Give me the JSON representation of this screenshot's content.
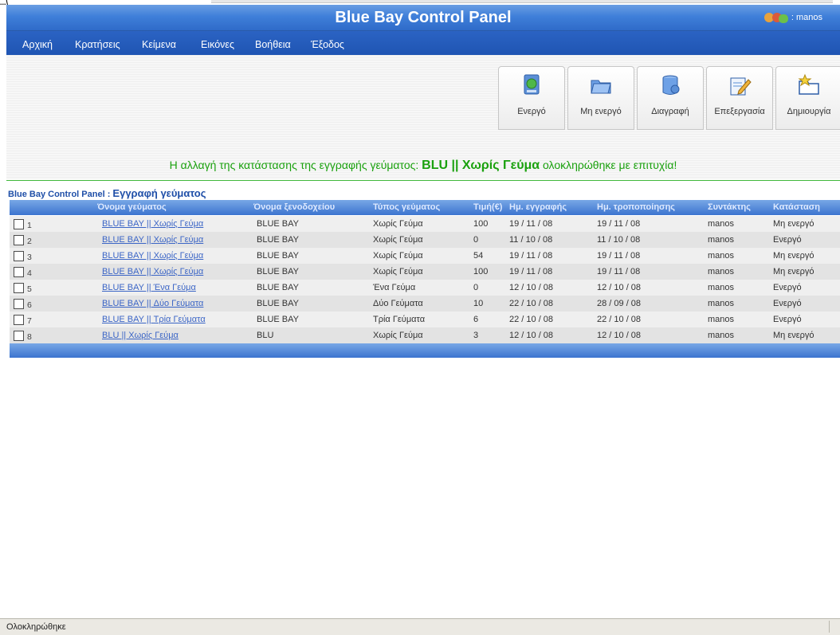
{
  "browser": {
    "title_fragment": "...\\"
  },
  "header": {
    "title": "Blue Bay Control Panel",
    "user": ": manos"
  },
  "nav": [
    "Αρχική",
    "Κρατήσεις",
    "Κείμενα",
    "Εικόνες",
    "Βοήθεια",
    "Έξοδος"
  ],
  "toolbar": {
    "activate": "Ενεργό",
    "deactivate": "Μη ενεργό",
    "delete": "Διαγραφή",
    "edit": "Επεξεργασία",
    "create": "Δημιουργία"
  },
  "message": {
    "prefix": "Η αλλαγή της κατάστασης της εγγραφής γεύματος:",
    "highlight": "BLU || Χωρίς Γεύμα",
    "suffix": "ολοκληρώθηκε με επιτυχία!"
  },
  "section": {
    "app": "Blue Bay Control Panel :",
    "title": "Εγγραφή γεύματος"
  },
  "table": {
    "headers": [
      "Όνομα γεύματος",
      "Όνομα ξενοδοχείου",
      "Τύπος γεύματος",
      "Τιμή(€)",
      "Ημ. εγγραφής",
      "Ημ. τροποποίησης",
      "Συντάκτης",
      "Κατάσταση"
    ],
    "rows": [
      {
        "num": "1",
        "name": "BLUE BAY || Χωρίς Γεύμα",
        "hotel": "BLUE BAY",
        "type": "Χωρίς Γεύμα",
        "price": "100",
        "created": "19 / 11 / 08",
        "modified": "19 / 11 / 08",
        "author": "manos",
        "status": "Μη ενεργό"
      },
      {
        "num": "2",
        "name": "BLUE BAY || Χωρίς Γεύμα",
        "hotel": "BLUE BAY",
        "type": "Χωρίς Γεύμα",
        "price": "0",
        "created": "11 / 10 / 08",
        "modified": "11 / 10 / 08",
        "author": "manos",
        "status": "Ενεργό"
      },
      {
        "num": "3",
        "name": "BLUE BAY || Χωρίς Γεύμα",
        "hotel": "BLUE BAY",
        "type": "Χωρίς Γεύμα",
        "price": "54",
        "created": "19 / 11 / 08",
        "modified": "19 / 11 / 08",
        "author": "manos",
        "status": "Μη ενεργό"
      },
      {
        "num": "4",
        "name": "BLUE BAY || Χωρίς Γεύμα",
        "hotel": "BLUE BAY",
        "type": "Χωρίς Γεύμα",
        "price": "100",
        "created": "19 / 11 / 08",
        "modified": "19 / 11 / 08",
        "author": "manos",
        "status": "Μη ενεργό"
      },
      {
        "num": "5",
        "name": "BLUE BAY || Ένα Γεύμα",
        "hotel": "BLUE BAY",
        "type": "Ένα Γεύμα",
        "price": "0",
        "created": "12 / 10 / 08",
        "modified": "12 / 10 / 08",
        "author": "manos",
        "status": "Ενεργό"
      },
      {
        "num": "6",
        "name": "BLUE BAY || Δύο Γεύματα",
        "hotel": "BLUE BAY",
        "type": "Δύο Γεύματα",
        "price": "10",
        "created": "22 / 10 / 08",
        "modified": "28 / 09 / 08",
        "author": "manos",
        "status": "Ενεργό"
      },
      {
        "num": "7",
        "name": "BLUE BAY || Τρία Γεύματα",
        "hotel": "BLUE BAY",
        "type": "Τρία Γεύματα",
        "price": "6",
        "created": "22 / 10 / 08",
        "modified": "22 / 10 / 08",
        "author": "manos",
        "status": "Ενεργό"
      },
      {
        "num": "8",
        "name": "BLU || Χωρίς Γεύμα",
        "hotel": "BLU",
        "type": "Χωρίς Γεύμα",
        "price": "3",
        "created": "12 / 10 / 08",
        "modified": "12 / 10 / 08",
        "author": "manos",
        "status": "Μη ενεργό"
      }
    ]
  },
  "statusbar": {
    "text": "Ολοκληρώθηκε"
  },
  "colors": {
    "header_blue": "#3f7fd9",
    "nav_blue": "#2b63c3",
    "success_green": "#1aa10e",
    "link_blue": "#3b65c6"
  }
}
